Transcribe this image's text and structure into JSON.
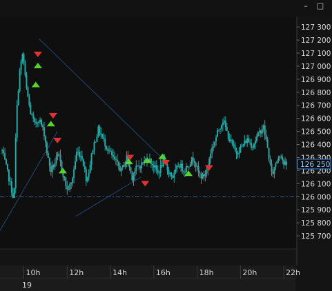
{
  "window": {
    "minimize_icon": "minimize-icon",
    "maximize_icon": "maximize-icon",
    "minimize_glyph": "–",
    "maximize_glyph": "□"
  },
  "date_label": "19",
  "colors": {
    "background": "#0f0f10",
    "candle": "#2aa8a4",
    "trendline": "#1e4a78",
    "reference_line": "#2f6ea8",
    "buy_marker": "#56d42b",
    "sell_marker": "#e03232",
    "axis_text": "#d8d8d8",
    "price_tag_border": "#3a8ee0"
  },
  "chart_data": {
    "type": "candlestick",
    "title": "",
    "xlabel": "",
    "ylabel": "",
    "x_ticks": [
      "10h",
      "12h",
      "14h",
      "16h",
      "18h",
      "20h",
      "22h"
    ],
    "x_tick_hours": [
      10,
      12,
      14,
      16,
      18,
      20,
      22
    ],
    "xlim": [
      8.9,
      22.6
    ],
    "y_ticks": [
      127300,
      127200,
      127100,
      127000,
      126900,
      126800,
      126700,
      126600,
      126500,
      126400,
      126300,
      126200,
      126100,
      126000,
      125900,
      125800,
      125700
    ],
    "y_tick_labels": [
      "127 300",
      "127 200",
      "127 100",
      "127 000",
      "126 900",
      "126 800",
      "126 700",
      "126 600",
      "126 500",
      "126 400",
      "126 300",
      "126 200",
      "126 100",
      "126 000",
      "125 900",
      "125 800",
      "125 700"
    ],
    "ylim": [
      125600,
      127380
    ],
    "current_price": 126250,
    "current_price_label": "126 250",
    "reference_level": 126000,
    "close_path": [
      [
        9.0,
        126350
      ],
      [
        9.3,
        126150
      ],
      [
        9.55,
        125970
      ],
      [
        9.65,
        126600
      ],
      [
        9.8,
        126950
      ],
      [
        9.95,
        127100
      ],
      [
        10.1,
        126850
      ],
      [
        10.3,
        126650
      ],
      [
        10.5,
        126550
      ],
      [
        10.7,
        126600
      ],
      [
        10.95,
        126480
      ],
      [
        11.1,
        126300
      ],
      [
        11.25,
        126200
      ],
      [
        11.4,
        126250
      ],
      [
        11.6,
        126320
      ],
      [
        11.8,
        126180
      ],
      [
        12.0,
        126050
      ],
      [
        12.2,
        126100
      ],
      [
        12.45,
        126350
      ],
      [
        12.7,
        126300
      ],
      [
        12.9,
        126120
      ],
      [
        13.0,
        126200
      ],
      [
        13.2,
        126380
      ],
      [
        13.45,
        126520
      ],
      [
        13.65,
        126440
      ],
      [
        13.9,
        126360
      ],
      [
        14.1,
        126300
      ],
      [
        14.3,
        126250
      ],
      [
        14.5,
        126200
      ],
      [
        14.75,
        126300
      ],
      [
        15.0,
        126150
      ],
      [
        15.2,
        126220
      ],
      [
        15.45,
        126250
      ],
      [
        15.7,
        126300
      ],
      [
        15.95,
        126250
      ],
      [
        16.2,
        126180
      ],
      [
        16.45,
        126280
      ],
      [
        16.65,
        126200
      ],
      [
        16.9,
        126150
      ],
      [
        17.15,
        126250
      ],
      [
        17.4,
        126200
      ],
      [
        17.6,
        126250
      ],
      [
        17.85,
        126300
      ],
      [
        18.05,
        126180
      ],
      [
        18.25,
        126150
      ],
      [
        18.45,
        126200
      ],
      [
        18.6,
        126330
      ],
      [
        18.8,
        126420
      ],
      [
        19.0,
        126520
      ],
      [
        19.2,
        126590
      ],
      [
        19.4,
        126480
      ],
      [
        19.6,
        126400
      ],
      [
        19.8,
        126340
      ],
      [
        20.05,
        126380
      ],
      [
        20.3,
        126440
      ],
      [
        20.55,
        126390
      ],
      [
        20.8,
        126470
      ],
      [
        21.05,
        126540
      ],
      [
        21.2,
        126420
      ],
      [
        21.45,
        126160
      ],
      [
        21.65,
        126270
      ],
      [
        21.85,
        126340
      ],
      [
        22.0,
        126250
      ],
      [
        22.15,
        126240
      ]
    ],
    "trendlines": [
      {
        "from": [
          10.7,
          127210
        ],
        "to": [
          16.35,
          126300
        ]
      },
      {
        "from": [
          8.9,
          125740
        ],
        "to": [
          11.55,
          126500
        ]
      },
      {
        "from": [
          12.4,
          125850
        ],
        "to": [
          15.4,
          126150
        ]
      }
    ],
    "buy_markers": [
      [
        10.65,
        127005
      ],
      [
        10.55,
        126860
      ],
      [
        11.25,
        126560
      ],
      [
        11.8,
        126200
      ],
      [
        14.85,
        126270
      ],
      [
        15.7,
        126280
      ],
      [
        16.4,
        126310
      ],
      [
        17.6,
        126180
      ]
    ],
    "sell_markers": [
      [
        10.65,
        127090
      ],
      [
        11.35,
        126620
      ],
      [
        11.55,
        126430
      ],
      [
        14.9,
        126300
      ],
      [
        15.6,
        126100
      ],
      [
        16.55,
        126260
      ],
      [
        18.55,
        126220
      ]
    ]
  }
}
